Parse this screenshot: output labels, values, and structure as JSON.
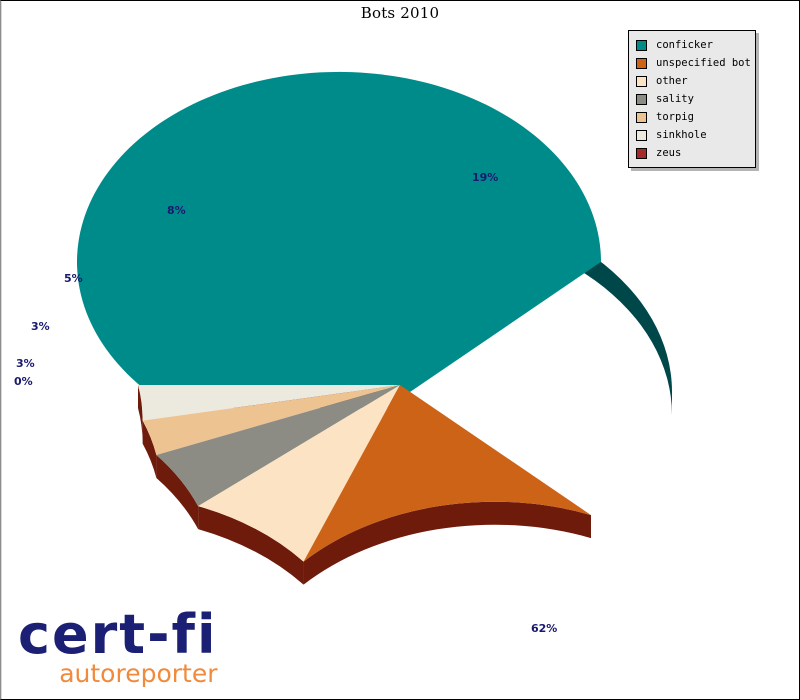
{
  "chart_data": {
    "type": "pie",
    "title": "Bots 2010",
    "xlabel": "",
    "ylabel": "",
    "legend_position": "top-right",
    "grid": false,
    "exploded_slice": "conficker",
    "three_d": true,
    "categories": [
      "conficker",
      "unspecified bot",
      "other",
      "sality",
      "torpig",
      "sinkhole",
      "zeus"
    ],
    "values": [
      62,
      19,
      8,
      5,
      3,
      3,
      0
    ],
    "labels": [
      "62%",
      "19%",
      "8%",
      "5%",
      "3%",
      "3%",
      "0%"
    ],
    "colors": [
      "#008b8b",
      "#cc6316",
      "#fbe3c4",
      "#8c8c85",
      "#eec392",
      "#eceade",
      "#a52a2a"
    ],
    "side_colors": [
      "#00474a",
      "#6e1b0c",
      "#6e1b0c",
      "#6e1b0c",
      "#6e1b0c",
      "#6e1b0c",
      "#6e1b0c"
    ],
    "series": [
      {
        "name": "Bots 2010",
        "points": [
          {
            "label": "conficker",
            "value": 62,
            "display": "62%",
            "color": "#008b8b"
          },
          {
            "label": "unspecified bot",
            "value": 19,
            "display": "19%",
            "color": "#cc6316"
          },
          {
            "label": "other",
            "value": 8,
            "display": "8%",
            "color": "#fbe3c4"
          },
          {
            "label": "sality",
            "value": 5,
            "display": "5%",
            "color": "#8c8c85"
          },
          {
            "label": "torpig",
            "value": 3,
            "display": "3%",
            "color": "#eec392"
          },
          {
            "label": "sinkhole",
            "value": 3,
            "display": "3%",
            "color": "#eceade"
          },
          {
            "label": "zeus",
            "value": 0,
            "display": "0%",
            "color": "#a52a2a"
          }
        ]
      }
    ]
  },
  "title": {
    "text": "Bots 2010"
  },
  "legend": {
    "items": [
      {
        "label": "conficker",
        "color": "#008b8b"
      },
      {
        "label": "unspecified bot",
        "color": "#cc6316"
      },
      {
        "label": "other",
        "color": "#fbe3c4"
      },
      {
        "label": "sality",
        "color": "#8c8c85"
      },
      {
        "label": "torpig",
        "color": "#eec392"
      },
      {
        "label": "sinkhole",
        "color": "#eceade"
      },
      {
        "label": "zeus",
        "color": "#a52a2a"
      }
    ]
  },
  "labels": {
    "conficker": "62%",
    "unspecified_bot": "19%",
    "other": "8%",
    "sality": "5%",
    "torpig": "3%",
    "sinkhole": "3%",
    "zeus": "0%"
  },
  "logo": {
    "main": "cert-fi",
    "sub": "autoreporter",
    "main_color": "#1b2074",
    "sub_color": "#f08a3c"
  },
  "colors": {
    "label_text": "#191970",
    "background": "#ffffff",
    "legend_bg": "#e9e9e9"
  }
}
